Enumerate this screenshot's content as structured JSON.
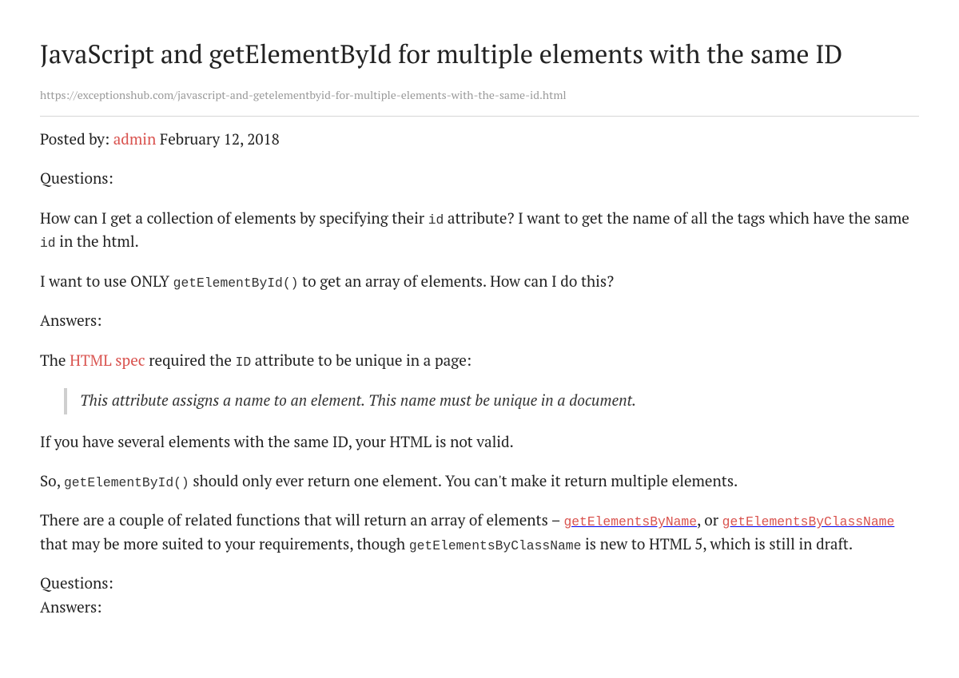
{
  "title": "JavaScript and getElementById for multiple elements with the same ID",
  "url": "https://exceptionshub.com/javascript-and-getelementbyid-for-multiple-elements-with-the-same-id.html",
  "meta": {
    "posted_by_label": "Posted by: ",
    "author": "admin",
    "date": " February 12, 2018"
  },
  "headings": {
    "questions": "Questions:",
    "answers": "Answers:"
  },
  "q1": {
    "t1": "How can I get a collection of elements by specifying their ",
    "c1": "id",
    "t2": " attribute? I want to get the name of all the tags which have the same ",
    "c2": "id",
    "t3": " in the html."
  },
  "q2": {
    "t1": "I want to use ONLY ",
    "c1": "getElementById()",
    "t2": " to get an array of elements. How can I do this?"
  },
  "a1": {
    "t1": "The ",
    "link": "HTML spec",
    "t2": " required the ",
    "c1": "ID",
    "t3": " attribute to be unique in a page:"
  },
  "quote": "This attribute assigns a name to an element. This name must be unique in a document.",
  "a2": "If you have several elements with the same ID, your HTML is not valid.",
  "a3": {
    "t1": "So, ",
    "c1": "getElementById()",
    "t2": " should only ever return one element. You can't make it return multiple elements."
  },
  "a4": {
    "t1": "There are a couple of related functions that will return an array of elements – ",
    "l1": "getElementsByName",
    "t2": ", or ",
    "l2": "getElementsByClassName",
    "t3": " that may be more suited to your requirements, though ",
    "c1": "getElementsByClassName",
    "t4": " is new to HTML 5, which is still in draft."
  }
}
